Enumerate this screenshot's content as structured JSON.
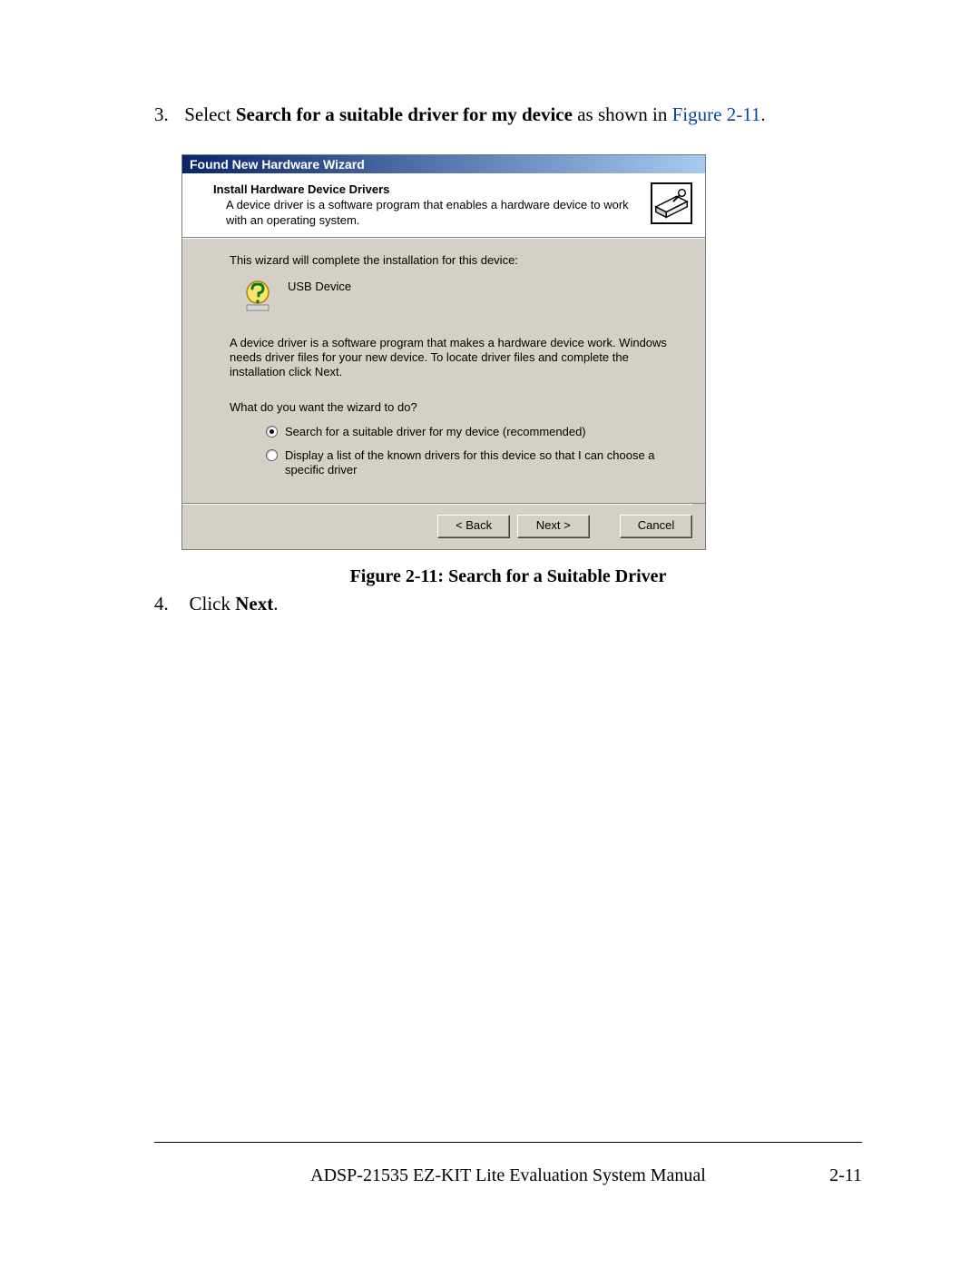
{
  "step3": {
    "number": "3.",
    "prefix": "Select ",
    "bold": "Search for a suitable driver for my device",
    "middle": " as shown in ",
    "figref": "Figure 2-11",
    "suffix": "."
  },
  "wizard": {
    "title": "Found New Hardware Wizard",
    "header_title": "Install Hardware Device Drivers",
    "header_sub": "A device driver is a software program that enables a hardware device to work with an operating system.",
    "line_complete": "This wizard will complete the installation for this device:",
    "device_name": "USB Device",
    "explain": "A device driver is a software program that makes a hardware device work. Windows needs driver files for your new device. To locate driver files and complete the installation click Next.",
    "prompt": "What do you want the wizard to do?",
    "option1": "Search for a suitable driver for my device (recommended)",
    "option2": "Display a list of the known drivers for this device so that I can choose a specific driver",
    "back": "< Back",
    "next": "Next >",
    "cancel": "Cancel"
  },
  "caption": "Figure 2-11: Search for a Suitable Driver",
  "step4": {
    "number": "4.",
    "prefix": "Click ",
    "bold": "Next",
    "suffix": "."
  },
  "footer": {
    "manual": "ADSP-21535 EZ-KIT Lite Evaluation System Manual",
    "page": "2-11"
  }
}
